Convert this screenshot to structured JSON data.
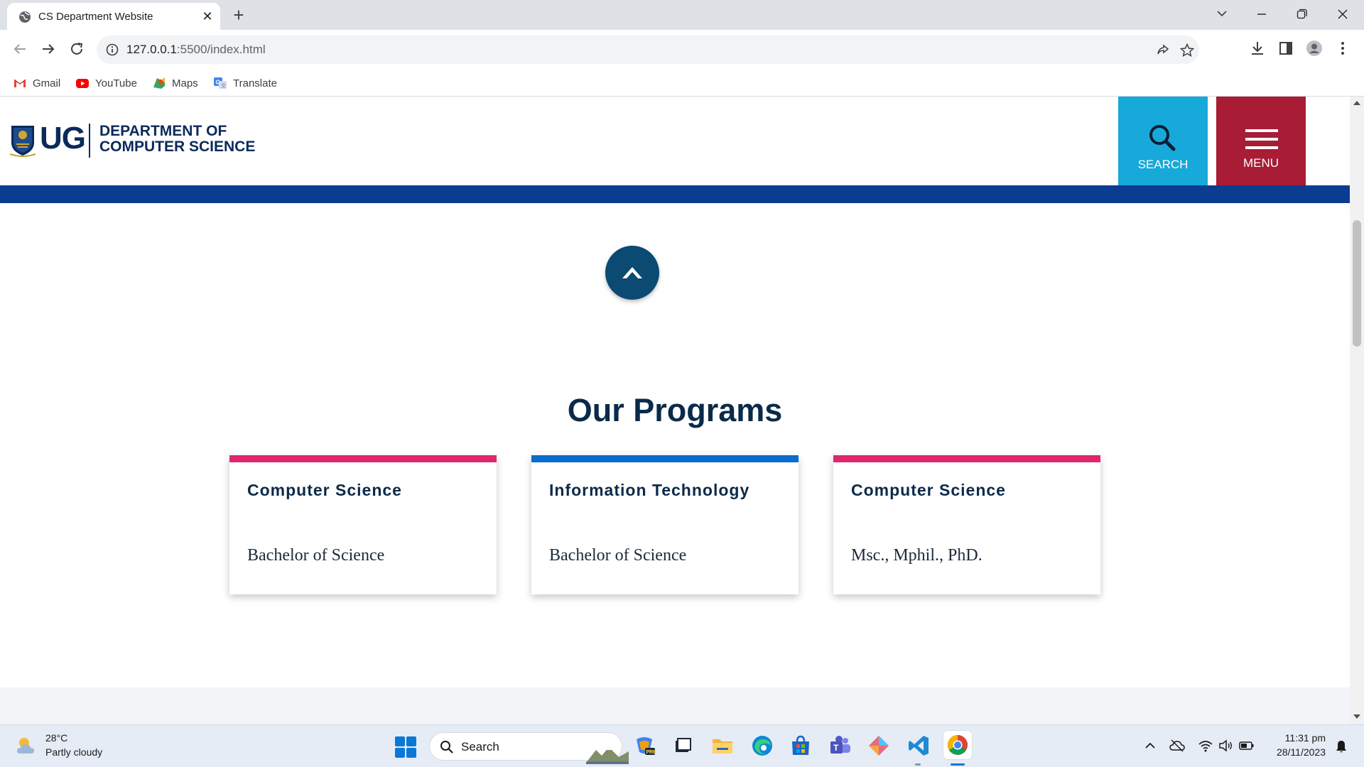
{
  "browser": {
    "tab_title": "CS Department Website",
    "tab_close": "✕",
    "new_tab": "+",
    "url_host": "127.0.0.1",
    "url_rest": ":5500/index.html",
    "bookmarks": [
      {
        "label": "Gmail",
        "icon": "gmail-icon"
      },
      {
        "label": "YouTube",
        "icon": "youtube-icon"
      },
      {
        "label": "Maps",
        "icon": "maps-icon"
      },
      {
        "label": "Translate",
        "icon": "translate-icon"
      }
    ]
  },
  "site": {
    "logo_ug": "UG",
    "dept_line1": "DEPARTMENT OF",
    "dept_line2": "COMPUTER SCIENCE",
    "search_label": "SEARCH",
    "menu_label": "MENU",
    "section_title": "Our Programs",
    "programs": [
      {
        "title": "Computer Science",
        "degree": "Bachelor of Science",
        "accent": "#e0266f"
      },
      {
        "title": "Information Technology",
        "degree": "Bachelor of Science",
        "accent": "#0b6bcf"
      },
      {
        "title": "Computer Science",
        "degree": "Msc., Mphil., PhD.",
        "accent": "#e0266f"
      }
    ]
  },
  "taskbar": {
    "weather_temp": "28°C",
    "weather_desc": "Partly cloudy",
    "search_label": "Search",
    "time": "11:31 pm",
    "date": "28/11/2023"
  },
  "colors": {
    "header_blue": "#0a3d91",
    "search_tile": "#16a9d9",
    "menu_tile": "#a81c35",
    "navy_text": "#0b2a4a"
  }
}
